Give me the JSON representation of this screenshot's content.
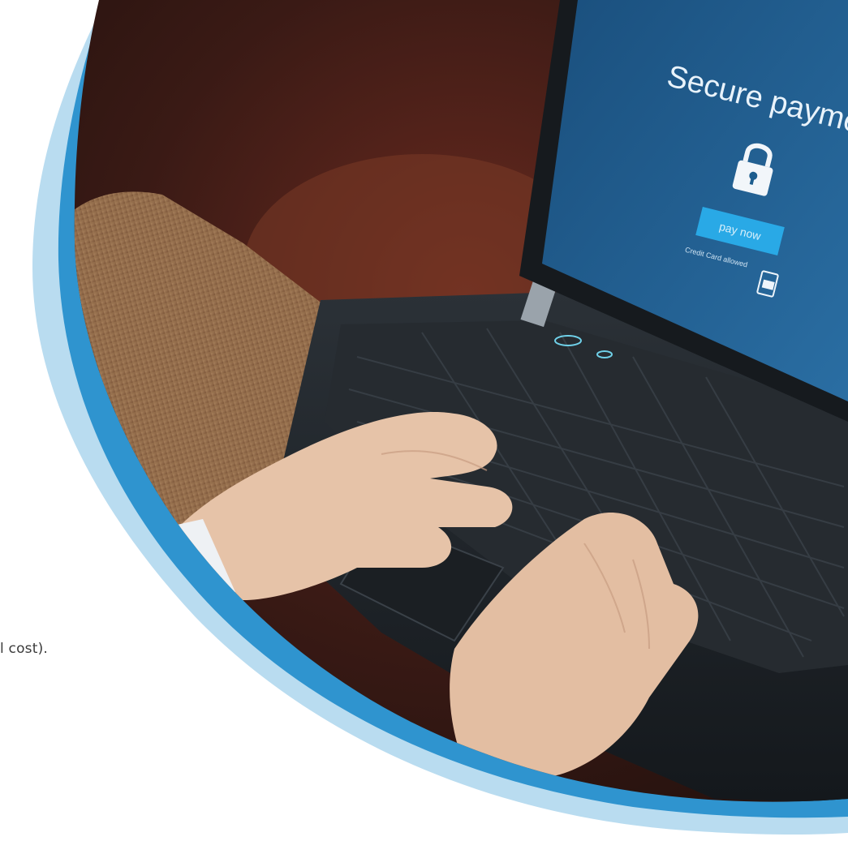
{
  "body_text_fragment": "l cost).",
  "photo": {
    "subject": "hands typing on laptop keyboard",
    "screen": {
      "heading": "Secure paymen",
      "button_label": "pay now",
      "caption": "Credit Card allowed",
      "lock_icon": "padlock-icon",
      "card_icon": "credit-card-icon"
    }
  },
  "colors": {
    "ring_light": "#b9dcf0",
    "ring_mid": "#2f94cf",
    "screen_blue": "#1d5d8e",
    "screen_button": "#29a9e6",
    "background_dark": "#2a1512",
    "sofa": "#a07a55",
    "laptop_body": "#1e2328",
    "key": "#262b30",
    "skin": "#e6c3a8",
    "text": "#3a3a3a"
  }
}
